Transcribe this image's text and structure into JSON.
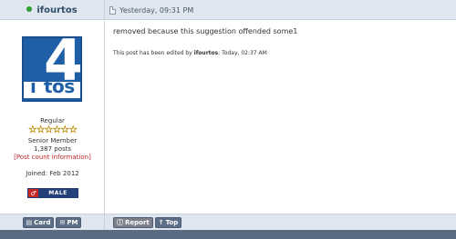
{
  "post": {
    "username": "ifourtos",
    "date": "Yesterday, 09:31 PM",
    "message": "removed because this suggestion offended some1",
    "edit_prefix": "This post has been edited by ",
    "edit_user": "ifourtos",
    "edit_suffix": ": Today, 02:37 AM"
  },
  "author": {
    "rank_title": "Regular",
    "stars": "☆☆☆☆☆☆",
    "member_type": "Senior Member",
    "posts": "1,387 posts",
    "post_count_info": "[Post count information]",
    "joined": "Joined: Feb 2012",
    "gender_symbol": "♂",
    "gender_label": "MALE",
    "avatar_letter_i": "i",
    "avatar_letters_tos": "tos",
    "avatar_big": "4"
  },
  "buttons": {
    "card": "Card",
    "pm": "PM",
    "report": "Report",
    "top": "Top"
  },
  "colors": {
    "header_bg": "#dfe6ef",
    "avatar_blue": "#1e5fa8",
    "online": "#2e9d32",
    "post_count_link": "#c0282d"
  },
  "icons": {
    "online": "online-status-dot",
    "post": "post-document-icon",
    "card": "card-icon",
    "pm": "mail-icon",
    "report": "report-icon",
    "top": "arrow-up-icon"
  }
}
